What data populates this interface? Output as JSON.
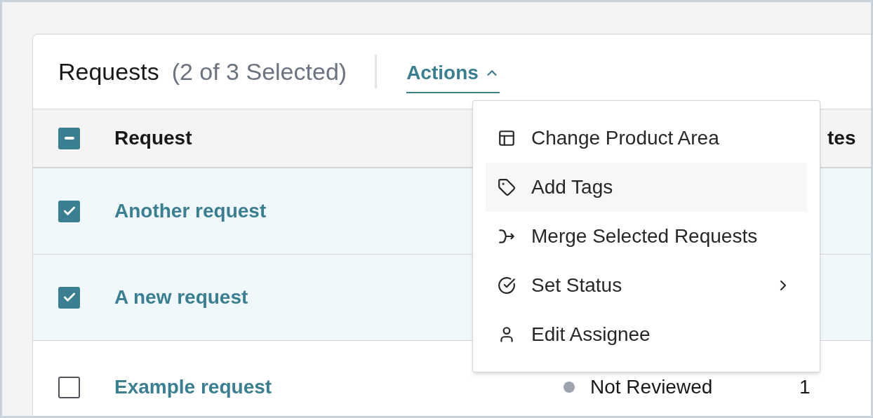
{
  "header": {
    "title": "Requests",
    "selection_count": "(2 of 3 Selected)",
    "actions": {
      "label": "Actions",
      "expanded": true
    }
  },
  "table": {
    "header_checkbox": {
      "indeterminate": true
    },
    "columns": [
      {
        "label": "Request"
      },
      {
        "label": "tes"
      }
    ],
    "rows": [
      {
        "title": "Another request",
        "selected": true
      },
      {
        "title": "A new request",
        "selected": true
      },
      {
        "title": "Example request",
        "selected": false,
        "status": "Not Reviewed",
        "color": "#9ca3af",
        "votes": "1"
      }
    ]
  },
  "actions_menu": {
    "items": [
      {
        "kind": "layout",
        "label": "Change Product Area",
        "highlighted": false,
        "submenu": false
      },
      {
        "kind": "tag",
        "label": "Add Tags",
        "highlighted": true,
        "submenu": false
      },
      {
        "kind": "merge",
        "label": "Merge Selected Requests",
        "highlighted": false,
        "submenu": false
      },
      {
        "kind": "status",
        "label": "Set Status",
        "highlighted": false,
        "submenu": true
      },
      {
        "kind": "assignee",
        "label": "Edit Assignee",
        "highlighted": false,
        "submenu": false
      }
    ]
  }
}
